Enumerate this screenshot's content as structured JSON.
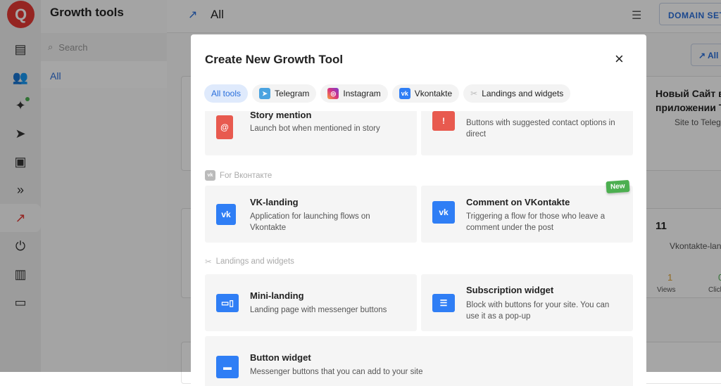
{
  "rail": {
    "logo": "Q",
    "items": [
      "chat-icon",
      "contacts-icon",
      "ai-sparkle-icon",
      "send-icon",
      "bot-icon",
      "flows-icon",
      "growth-icon",
      "integrations-icon",
      "analytics-icon",
      "archive-icon"
    ]
  },
  "panel": {
    "title": "Growth tools",
    "search_placeholder": "Search",
    "items": [
      {
        "label": "All"
      }
    ]
  },
  "header": {
    "title": "All",
    "domain_settings": "DOMAIN SETTINGS",
    "all_button": "All"
  },
  "background_cards": [
    {
      "title_line1": "Новый Сайт в",
      "title_line2": "приложении Т",
      "type": "Site to Telegram"
    },
    {
      "title": "11",
      "type": "Vkontakte-landing",
      "views": "1",
      "views_label": "Views",
      "clicks": "0",
      "clicks_label": "Clicks"
    }
  ],
  "modal": {
    "title": "Create New Growth Tool",
    "close": "×",
    "filters": [
      {
        "label": "All tools",
        "active": true
      },
      {
        "label": "Telegram"
      },
      {
        "label": "Instagram"
      },
      {
        "label": "Vkontakte"
      },
      {
        "label": "Landings and widgets"
      }
    ],
    "cards_top": [
      {
        "title": "Story mention",
        "desc": "Launch bot when mentioned in story"
      },
      {
        "title": "",
        "desc": "Buttons with suggested contact options in direct"
      }
    ],
    "sections": [
      {
        "label": "For Вконтакте",
        "cards": [
          {
            "title": "VK-landing",
            "desc": "Application for launching flows on Vkontakte"
          },
          {
            "title": "Comment on VKontakte",
            "desc": "Triggering a flow for those who leave a comment under the post",
            "badge": "New"
          }
        ]
      },
      {
        "label": "Landings and widgets",
        "cards": [
          {
            "title": "Mini-landing",
            "desc": "Landing page with messenger buttons"
          },
          {
            "title": "Subscription widget",
            "desc": "Block with buttons for your site. You can use it as a pop-up"
          },
          {
            "title": "Button widget",
            "desc": "Messenger buttons that you can add to your site"
          }
        ]
      }
    ]
  },
  "colors": {
    "accent": "#2a6fdb",
    "brand": "#e53935",
    "instagram_red": "#e85a4f",
    "vk": "#2f7ef5",
    "new": "#4caf50"
  }
}
